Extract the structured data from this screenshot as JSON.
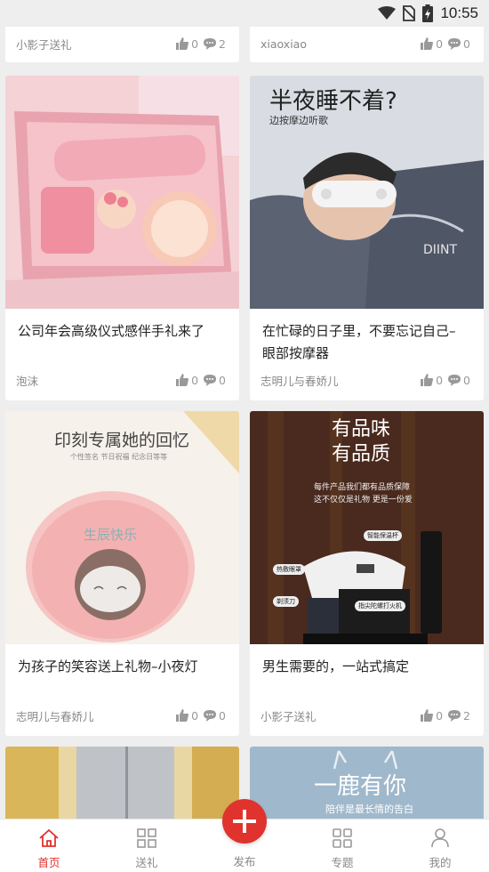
{
  "status_bar": {
    "time": "10:55"
  },
  "top_cards": [
    {
      "author": "小影子送礼",
      "likes": "0",
      "comments": "2"
    },
    {
      "author": "xiaoxiao",
      "likes": "0",
      "comments": "0"
    }
  ],
  "cards": [
    {
      "title": "公司年会高级仪式感伴手礼来了",
      "author": "泡沫",
      "likes": "0",
      "comments": "0"
    },
    {
      "title": "在忙碌的日子里，不要忘记自己–眼部按摩器",
      "title_line1": "在忙碌的日子里，不要忘记自己–",
      "title_line2": "眼部按摩器",
      "author": "志明儿与春娇儿",
      "likes": "0",
      "comments": "0",
      "image_text": {
        "headline": "半夜睡不着?",
        "sub": "边按摩边听歌"
      }
    },
    {
      "title": "为孩子的笑容送上礼物–小夜灯",
      "author": "志明儿与春娇儿",
      "likes": "0",
      "comments": "0",
      "image_text": {
        "headline": "印刻专属她的回忆",
        "sub": "个性签名 节日祝福 纪念日等等",
        "lamp_text": "生辰快乐"
      }
    },
    {
      "title": "男生需要的，一站式搞定",
      "author": "小影子送礼",
      "likes": "0",
      "comments": "2",
      "image_text": {
        "headline1": "有品味",
        "headline2": "有品质",
        "sub1": "每件产品我们都有品质保障",
        "sub2": "这不仅仅是礼物 更是一份爱",
        "tag1": "智能保温杯",
        "tag2": "热敷眼罩",
        "tag3": "剃须刀",
        "tag4": "指尖陀螺打火机"
      }
    }
  ],
  "bottom_cards": [
    {
      "image_text": {
        "headline": "一鹿有你",
        "sub": "陪伴是最长情的告白"
      }
    }
  ],
  "tabbar": {
    "home": "首页",
    "gift": "送礼",
    "publish": "发布",
    "topics": "专题",
    "mine": "我的"
  },
  "colors": {
    "accent": "#e0332d",
    "background": "#eeeeee",
    "card": "#ffffff",
    "muted": "#888888"
  }
}
